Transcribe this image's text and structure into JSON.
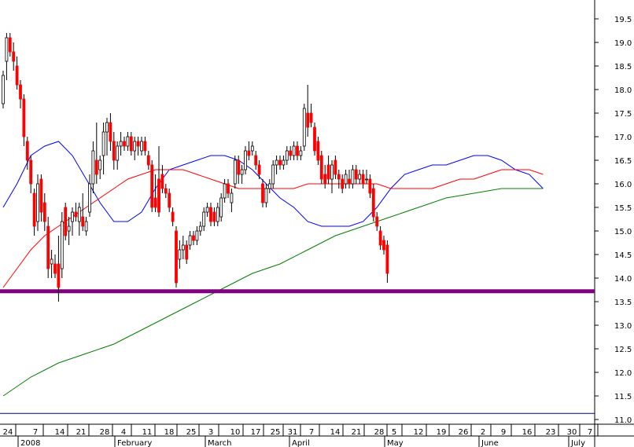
{
  "chart_data": {
    "type": "candlestick",
    "y_axis": {
      "position": "right",
      "ylim": [
        10.9,
        19.9
      ],
      "ticks": [
        11.0,
        11.5,
        12.0,
        12.5,
        13.0,
        13.5,
        14.0,
        14.5,
        15.0,
        15.5,
        16.0,
        16.5,
        17.0,
        17.5,
        18.0,
        18.5,
        19.0,
        19.5
      ]
    },
    "x_axis": {
      "day_ticks": [
        "24",
        "7",
        "14",
        "21",
        "28",
        "4",
        "11",
        "18",
        "25",
        "3",
        "10",
        "17",
        "25",
        "31",
        "7",
        "14",
        "21",
        "28",
        "5",
        "12",
        "19",
        "26",
        "2",
        "9",
        "16",
        "23",
        "30",
        "7"
      ],
      "month_labels": [
        "2008",
        "February",
        "March",
        "April",
        "May",
        "June",
        "July"
      ]
    },
    "colors": {
      "up": "#ffffff",
      "down": "#ff0000",
      "wick": "#000000",
      "ma_short": "#0000ff",
      "ma_mid": "#ff0000",
      "ma_long": "#008000",
      "support": "#800080",
      "baseline": "#000080"
    },
    "support_level": 13.72,
    "baseline_level": 11.13,
    "candles": [
      {
        "o": 17.7,
        "h": 18.4,
        "l": 17.6,
        "c": 18.3
      },
      {
        "o": 18.6,
        "h": 19.2,
        "l": 18.2,
        "c": 19.1
      },
      {
        "o": 19.1,
        "h": 19.2,
        "l": 18.7,
        "c": 18.8
      },
      {
        "o": 18.8,
        "h": 19.0,
        "l": 18.4,
        "c": 18.6
      },
      {
        "o": 18.5,
        "h": 18.7,
        "l": 18.0,
        "c": 18.1
      },
      {
        "o": 18.1,
        "h": 18.2,
        "l": 17.6,
        "c": 17.8
      },
      {
        "o": 17.8,
        "h": 17.9,
        "l": 16.8,
        "c": 17.0
      },
      {
        "o": 16.9,
        "h": 17.0,
        "l": 16.3,
        "c": 16.5
      },
      {
        "o": 16.5,
        "h": 16.6,
        "l": 15.8,
        "c": 16.0
      },
      {
        "o": 15.8,
        "h": 15.9,
        "l": 14.9,
        "c": 15.1
      },
      {
        "o": 15.2,
        "h": 16.2,
        "l": 15.0,
        "c": 16.0
      },
      {
        "o": 16.1,
        "h": 16.2,
        "l": 15.2,
        "c": 15.4
      },
      {
        "o": 15.6,
        "h": 15.8,
        "l": 15.0,
        "c": 15.2
      },
      {
        "o": 15.1,
        "h": 15.3,
        "l": 14.0,
        "c": 14.2
      },
      {
        "o": 14.3,
        "h": 14.6,
        "l": 14.0,
        "c": 14.4
      },
      {
        "o": 14.3,
        "h": 14.5,
        "l": 14.0,
        "c": 14.1
      },
      {
        "o": 14.3,
        "h": 14.9,
        "l": 13.5,
        "c": 13.8
      },
      {
        "o": 14.2,
        "h": 15.4,
        "l": 14.0,
        "c": 15.2
      },
      {
        "o": 15.5,
        "h": 15.6,
        "l": 14.8,
        "c": 14.9
      },
      {
        "o": 15.0,
        "h": 15.3,
        "l": 14.7,
        "c": 15.1
      },
      {
        "o": 15.2,
        "h": 15.5,
        "l": 14.9,
        "c": 15.4
      },
      {
        "o": 15.4,
        "h": 15.6,
        "l": 15.2,
        "c": 15.3
      },
      {
        "o": 15.2,
        "h": 15.6,
        "l": 14.9,
        "c": 15.5
      },
      {
        "o": 15.3,
        "h": 15.8,
        "l": 15.0,
        "c": 15.1
      },
      {
        "o": 15.0,
        "h": 15.3,
        "l": 14.9,
        "c": 15.2
      },
      {
        "o": 15.4,
        "h": 16.2,
        "l": 15.3,
        "c": 16.0
      },
      {
        "o": 16.0,
        "h": 16.9,
        "l": 15.8,
        "c": 16.7
      },
      {
        "o": 16.5,
        "h": 17.3,
        "l": 16.0,
        "c": 16.2
      },
      {
        "o": 16.3,
        "h": 16.6,
        "l": 16.1,
        "c": 16.5
      },
      {
        "o": 16.6,
        "h": 17.3,
        "l": 16.2,
        "c": 17.1
      },
      {
        "o": 17.1,
        "h": 17.4,
        "l": 16.6,
        "c": 17.3
      },
      {
        "o": 17.3,
        "h": 17.5,
        "l": 16.7,
        "c": 16.9
      },
      {
        "o": 16.9,
        "h": 17.1,
        "l": 16.3,
        "c": 16.5
      },
      {
        "o": 16.5,
        "h": 16.9,
        "l": 16.3,
        "c": 16.8
      },
      {
        "o": 16.8,
        "h": 17.1,
        "l": 16.6,
        "c": 16.9
      },
      {
        "o": 16.9,
        "h": 17.0,
        "l": 16.7,
        "c": 16.8
      },
      {
        "o": 16.8,
        "h": 17.1,
        "l": 16.7,
        "c": 17.0
      },
      {
        "o": 17.0,
        "h": 17.1,
        "l": 16.6,
        "c": 16.7
      },
      {
        "o": 16.7,
        "h": 17.0,
        "l": 16.5,
        "c": 16.9
      },
      {
        "o": 16.9,
        "h": 17.0,
        "l": 16.6,
        "c": 16.8
      },
      {
        "o": 16.7,
        "h": 17.0,
        "l": 16.6,
        "c": 16.9
      },
      {
        "o": 16.9,
        "h": 17.0,
        "l": 16.6,
        "c": 16.7
      },
      {
        "o": 16.6,
        "h": 16.7,
        "l": 16.3,
        "c": 16.4
      },
      {
        "o": 16.4,
        "h": 16.5,
        "l": 15.4,
        "c": 15.5
      },
      {
        "o": 15.7,
        "h": 16.2,
        "l": 15.4,
        "c": 15.5
      },
      {
        "o": 16.1,
        "h": 16.8,
        "l": 15.3,
        "c": 15.4
      },
      {
        "o": 16.2,
        "h": 16.4,
        "l": 15.8,
        "c": 15.9
      },
      {
        "o": 15.9,
        "h": 16.0,
        "l": 15.7,
        "c": 15.8
      },
      {
        "o": 15.8,
        "h": 15.9,
        "l": 15.4,
        "c": 15.5
      },
      {
        "o": 15.4,
        "h": 15.5,
        "l": 15.1,
        "c": 15.2
      },
      {
        "o": 15.0,
        "h": 15.1,
        "l": 13.8,
        "c": 13.9
      },
      {
        "o": 14.4,
        "h": 14.8,
        "l": 14.2,
        "c": 14.6
      },
      {
        "o": 14.6,
        "h": 14.9,
        "l": 14.4,
        "c": 14.7
      },
      {
        "o": 14.7,
        "h": 14.8,
        "l": 14.3,
        "c": 14.4
      },
      {
        "o": 14.7,
        "h": 15.0,
        "l": 14.6,
        "c": 14.9
      },
      {
        "o": 14.9,
        "h": 15.0,
        "l": 14.7,
        "c": 14.8
      },
      {
        "o": 14.8,
        "h": 15.1,
        "l": 14.7,
        "c": 15.0
      },
      {
        "o": 15.0,
        "h": 15.2,
        "l": 14.9,
        "c": 15.1
      },
      {
        "o": 15.1,
        "h": 15.5,
        "l": 15.0,
        "c": 15.4
      },
      {
        "o": 15.4,
        "h": 15.6,
        "l": 15.3,
        "c": 15.5
      },
      {
        "o": 15.5,
        "h": 15.6,
        "l": 15.1,
        "c": 15.2
      },
      {
        "o": 15.4,
        "h": 15.5,
        "l": 15.1,
        "c": 15.2
      },
      {
        "o": 15.2,
        "h": 15.6,
        "l": 15.1,
        "c": 15.5
      },
      {
        "o": 15.3,
        "h": 15.8,
        "l": 15.2,
        "c": 15.7
      },
      {
        "o": 15.7,
        "h": 16.1,
        "l": 15.6,
        "c": 16.0
      },
      {
        "o": 16.0,
        "h": 16.1,
        "l": 15.7,
        "c": 15.8
      },
      {
        "o": 15.6,
        "h": 15.9,
        "l": 15.4,
        "c": 15.8
      },
      {
        "o": 16.0,
        "h": 16.6,
        "l": 15.9,
        "c": 16.5
      },
      {
        "o": 16.5,
        "h": 16.6,
        "l": 16.0,
        "c": 16.2
      },
      {
        "o": 16.2,
        "h": 16.4,
        "l": 16.0,
        "c": 16.3
      },
      {
        "o": 16.3,
        "h": 16.8,
        "l": 16.2,
        "c": 16.7
      },
      {
        "o": 16.7,
        "h": 16.9,
        "l": 16.5,
        "c": 16.6
      },
      {
        "o": 16.7,
        "h": 16.9,
        "l": 16.6,
        "c": 16.8
      },
      {
        "o": 16.6,
        "h": 16.7,
        "l": 16.3,
        "c": 16.4
      },
      {
        "o": 16.4,
        "h": 16.5,
        "l": 16.1,
        "c": 16.2
      },
      {
        "o": 16.0,
        "h": 16.1,
        "l": 15.5,
        "c": 15.6
      },
      {
        "o": 15.6,
        "h": 16.0,
        "l": 15.5,
        "c": 15.9
      },
      {
        "o": 15.9,
        "h": 16.1,
        "l": 15.8,
        "c": 16.0
      },
      {
        "o": 16.0,
        "h": 16.5,
        "l": 15.9,
        "c": 16.4
      },
      {
        "o": 16.4,
        "h": 16.6,
        "l": 16.2,
        "c": 16.5
      },
      {
        "o": 16.5,
        "h": 16.6,
        "l": 16.3,
        "c": 16.4
      },
      {
        "o": 16.4,
        "h": 16.6,
        "l": 16.3,
        "c": 16.5
      },
      {
        "o": 16.5,
        "h": 16.8,
        "l": 16.4,
        "c": 16.7
      },
      {
        "o": 16.7,
        "h": 16.8,
        "l": 16.5,
        "c": 16.6
      },
      {
        "o": 16.6,
        "h": 16.9,
        "l": 16.5,
        "c": 16.8
      },
      {
        "o": 16.8,
        "h": 16.9,
        "l": 16.5,
        "c": 16.6
      },
      {
        "o": 16.6,
        "h": 16.8,
        "l": 16.5,
        "c": 16.7
      },
      {
        "o": 16.8,
        "h": 17.7,
        "l": 16.7,
        "c": 17.6
      },
      {
        "o": 17.5,
        "h": 18.1,
        "l": 17.0,
        "c": 17.2
      },
      {
        "o": 17.5,
        "h": 17.7,
        "l": 17.2,
        "c": 17.3
      },
      {
        "o": 17.2,
        "h": 17.3,
        "l": 16.6,
        "c": 16.7
      },
      {
        "o": 16.9,
        "h": 17.0,
        "l": 16.4,
        "c": 16.5
      },
      {
        "o": 16.6,
        "h": 16.7,
        "l": 16.0,
        "c": 16.1
      },
      {
        "o": 16.2,
        "h": 16.4,
        "l": 15.9,
        "c": 16.0
      },
      {
        "o": 16.4,
        "h": 16.6,
        "l": 16.0,
        "c": 16.1
      },
      {
        "o": 16.1,
        "h": 16.5,
        "l": 15.8,
        "c": 16.4
      },
      {
        "o": 16.5,
        "h": 16.6,
        "l": 16.1,
        "c": 16.2
      },
      {
        "o": 16.2,
        "h": 16.3,
        "l": 15.9,
        "c": 16.1
      },
      {
        "o": 16.1,
        "h": 16.2,
        "l": 15.8,
        "c": 15.9
      },
      {
        "o": 16.0,
        "h": 16.3,
        "l": 15.9,
        "c": 16.2
      },
      {
        "o": 16.1,
        "h": 16.3,
        "l": 15.9,
        "c": 16.0
      },
      {
        "o": 16.0,
        "h": 16.4,
        "l": 15.9,
        "c": 16.3
      },
      {
        "o": 16.3,
        "h": 16.4,
        "l": 16.0,
        "c": 16.1
      },
      {
        "o": 16.1,
        "h": 16.3,
        "l": 16.0,
        "c": 16.2
      },
      {
        "o": 16.2,
        "h": 16.3,
        "l": 15.9,
        "c": 16.0
      },
      {
        "o": 16.1,
        "h": 16.3,
        "l": 16.0,
        "c": 16.1
      },
      {
        "o": 16.1,
        "h": 16.2,
        "l": 15.7,
        "c": 15.8
      },
      {
        "o": 15.9,
        "h": 16.0,
        "l": 15.2,
        "c": 15.3
      },
      {
        "o": 15.3,
        "h": 15.4,
        "l": 15.0,
        "c": 15.1
      },
      {
        "o": 15.0,
        "h": 15.1,
        "l": 14.6,
        "c": 14.7
      },
      {
        "o": 14.8,
        "h": 14.9,
        "l": 14.5,
        "c": 14.6
      },
      {
        "o": 14.7,
        "h": 14.8,
        "l": 13.9,
        "c": 14.1
      }
    ],
    "moving_averages": [
      {
        "name": "",
        "color": "#0000ff",
        "points": [
          [
            0,
            15.5
          ],
          [
            4,
            16.0
          ],
          [
            8,
            16.6
          ],
          [
            12,
            16.8
          ],
          [
            16,
            16.9
          ],
          [
            20,
            16.6
          ],
          [
            24,
            16.1
          ],
          [
            28,
            15.6
          ],
          [
            32,
            15.2
          ],
          [
            36,
            15.2
          ],
          [
            40,
            15.4
          ],
          [
            44,
            15.9
          ],
          [
            48,
            16.3
          ],
          [
            52,
            16.4
          ],
          [
            56,
            16.5
          ],
          [
            60,
            16.6
          ],
          [
            64,
            16.6
          ],
          [
            68,
            16.5
          ],
          [
            72,
            16.3
          ],
          [
            76,
            16.0
          ],
          [
            80,
            15.7
          ],
          [
            84,
            15.5
          ],
          [
            88,
            15.2
          ],
          [
            92,
            15.1
          ],
          [
            96,
            15.1
          ],
          [
            100,
            15.1
          ],
          [
            104,
            15.2
          ],
          [
            108,
            15.5
          ],
          [
            112,
            15.9
          ],
          [
            116,
            16.2
          ],
          [
            120,
            16.3
          ],
          [
            124,
            16.4
          ],
          [
            128,
            16.4
          ],
          [
            132,
            16.5
          ],
          [
            136,
            16.6
          ],
          [
            140,
            16.6
          ],
          [
            144,
            16.5
          ],
          [
            148,
            16.3
          ],
          [
            152,
            16.2
          ],
          [
            156,
            15.9
          ]
        ]
      },
      {
        "name": "",
        "color": "#ff0000",
        "points": [
          [
            0,
            13.8
          ],
          [
            4,
            14.2
          ],
          [
            8,
            14.6
          ],
          [
            12,
            14.9
          ],
          [
            16,
            15.1
          ],
          [
            20,
            15.3
          ],
          [
            24,
            15.5
          ],
          [
            28,
            15.7
          ],
          [
            32,
            15.9
          ],
          [
            36,
            16.1
          ],
          [
            40,
            16.2
          ],
          [
            44,
            16.3
          ],
          [
            48,
            16.3
          ],
          [
            52,
            16.3
          ],
          [
            56,
            16.2
          ],
          [
            60,
            16.1
          ],
          [
            64,
            16.0
          ],
          [
            68,
            15.9
          ],
          [
            72,
            15.9
          ],
          [
            76,
            15.9
          ],
          [
            80,
            15.9
          ],
          [
            84,
            15.9
          ],
          [
            88,
            16.0
          ],
          [
            92,
            16.0
          ],
          [
            96,
            16.0
          ],
          [
            100,
            16.0
          ],
          [
            104,
            16.0
          ],
          [
            108,
            16.0
          ],
          [
            112,
            15.9
          ],
          [
            116,
            15.9
          ],
          [
            120,
            15.9
          ],
          [
            124,
            15.9
          ],
          [
            128,
            16.0
          ],
          [
            132,
            16.1
          ],
          [
            136,
            16.1
          ],
          [
            140,
            16.2
          ],
          [
            144,
            16.3
          ],
          [
            148,
            16.3
          ],
          [
            152,
            16.3
          ],
          [
            156,
            16.2
          ]
        ]
      },
      {
        "name": "",
        "color": "#008000",
        "points": [
          [
            0,
            11.5
          ],
          [
            8,
            11.9
          ],
          [
            16,
            12.2
          ],
          [
            24,
            12.4
          ],
          [
            32,
            12.6
          ],
          [
            40,
            12.9
          ],
          [
            48,
            13.2
          ],
          [
            56,
            13.5
          ],
          [
            64,
            13.8
          ],
          [
            72,
            14.1
          ],
          [
            80,
            14.3
          ],
          [
            88,
            14.6
          ],
          [
            96,
            14.9
          ],
          [
            104,
            15.1
          ],
          [
            112,
            15.3
          ],
          [
            120,
            15.5
          ],
          [
            128,
            15.7
          ],
          [
            136,
            15.8
          ],
          [
            144,
            15.9
          ],
          [
            152,
            15.9
          ],
          [
            156,
            15.9
          ]
        ]
      }
    ]
  }
}
